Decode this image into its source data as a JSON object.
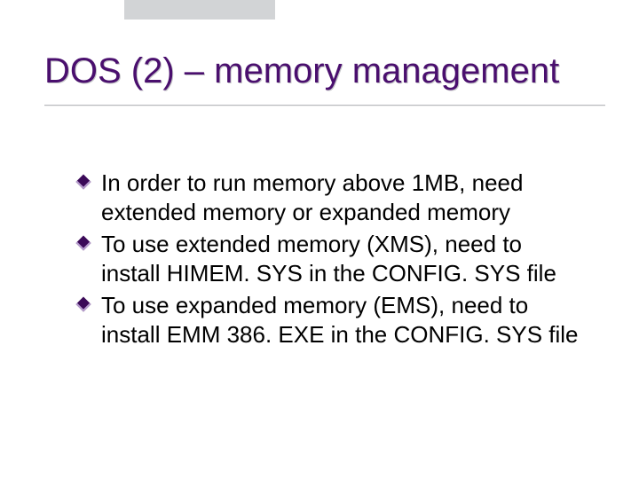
{
  "title": "DOS (2) – memory management",
  "bullets": [
    "In order to run memory above 1MB, need extended memory or expanded memory",
    "To use extended memory (XMS), need to install HIMEM. SYS in the CONFIG. SYS file",
    "To use expanded memory (EMS), need to install EMM 386. EXE in the CONFIG. SYS file"
  ]
}
